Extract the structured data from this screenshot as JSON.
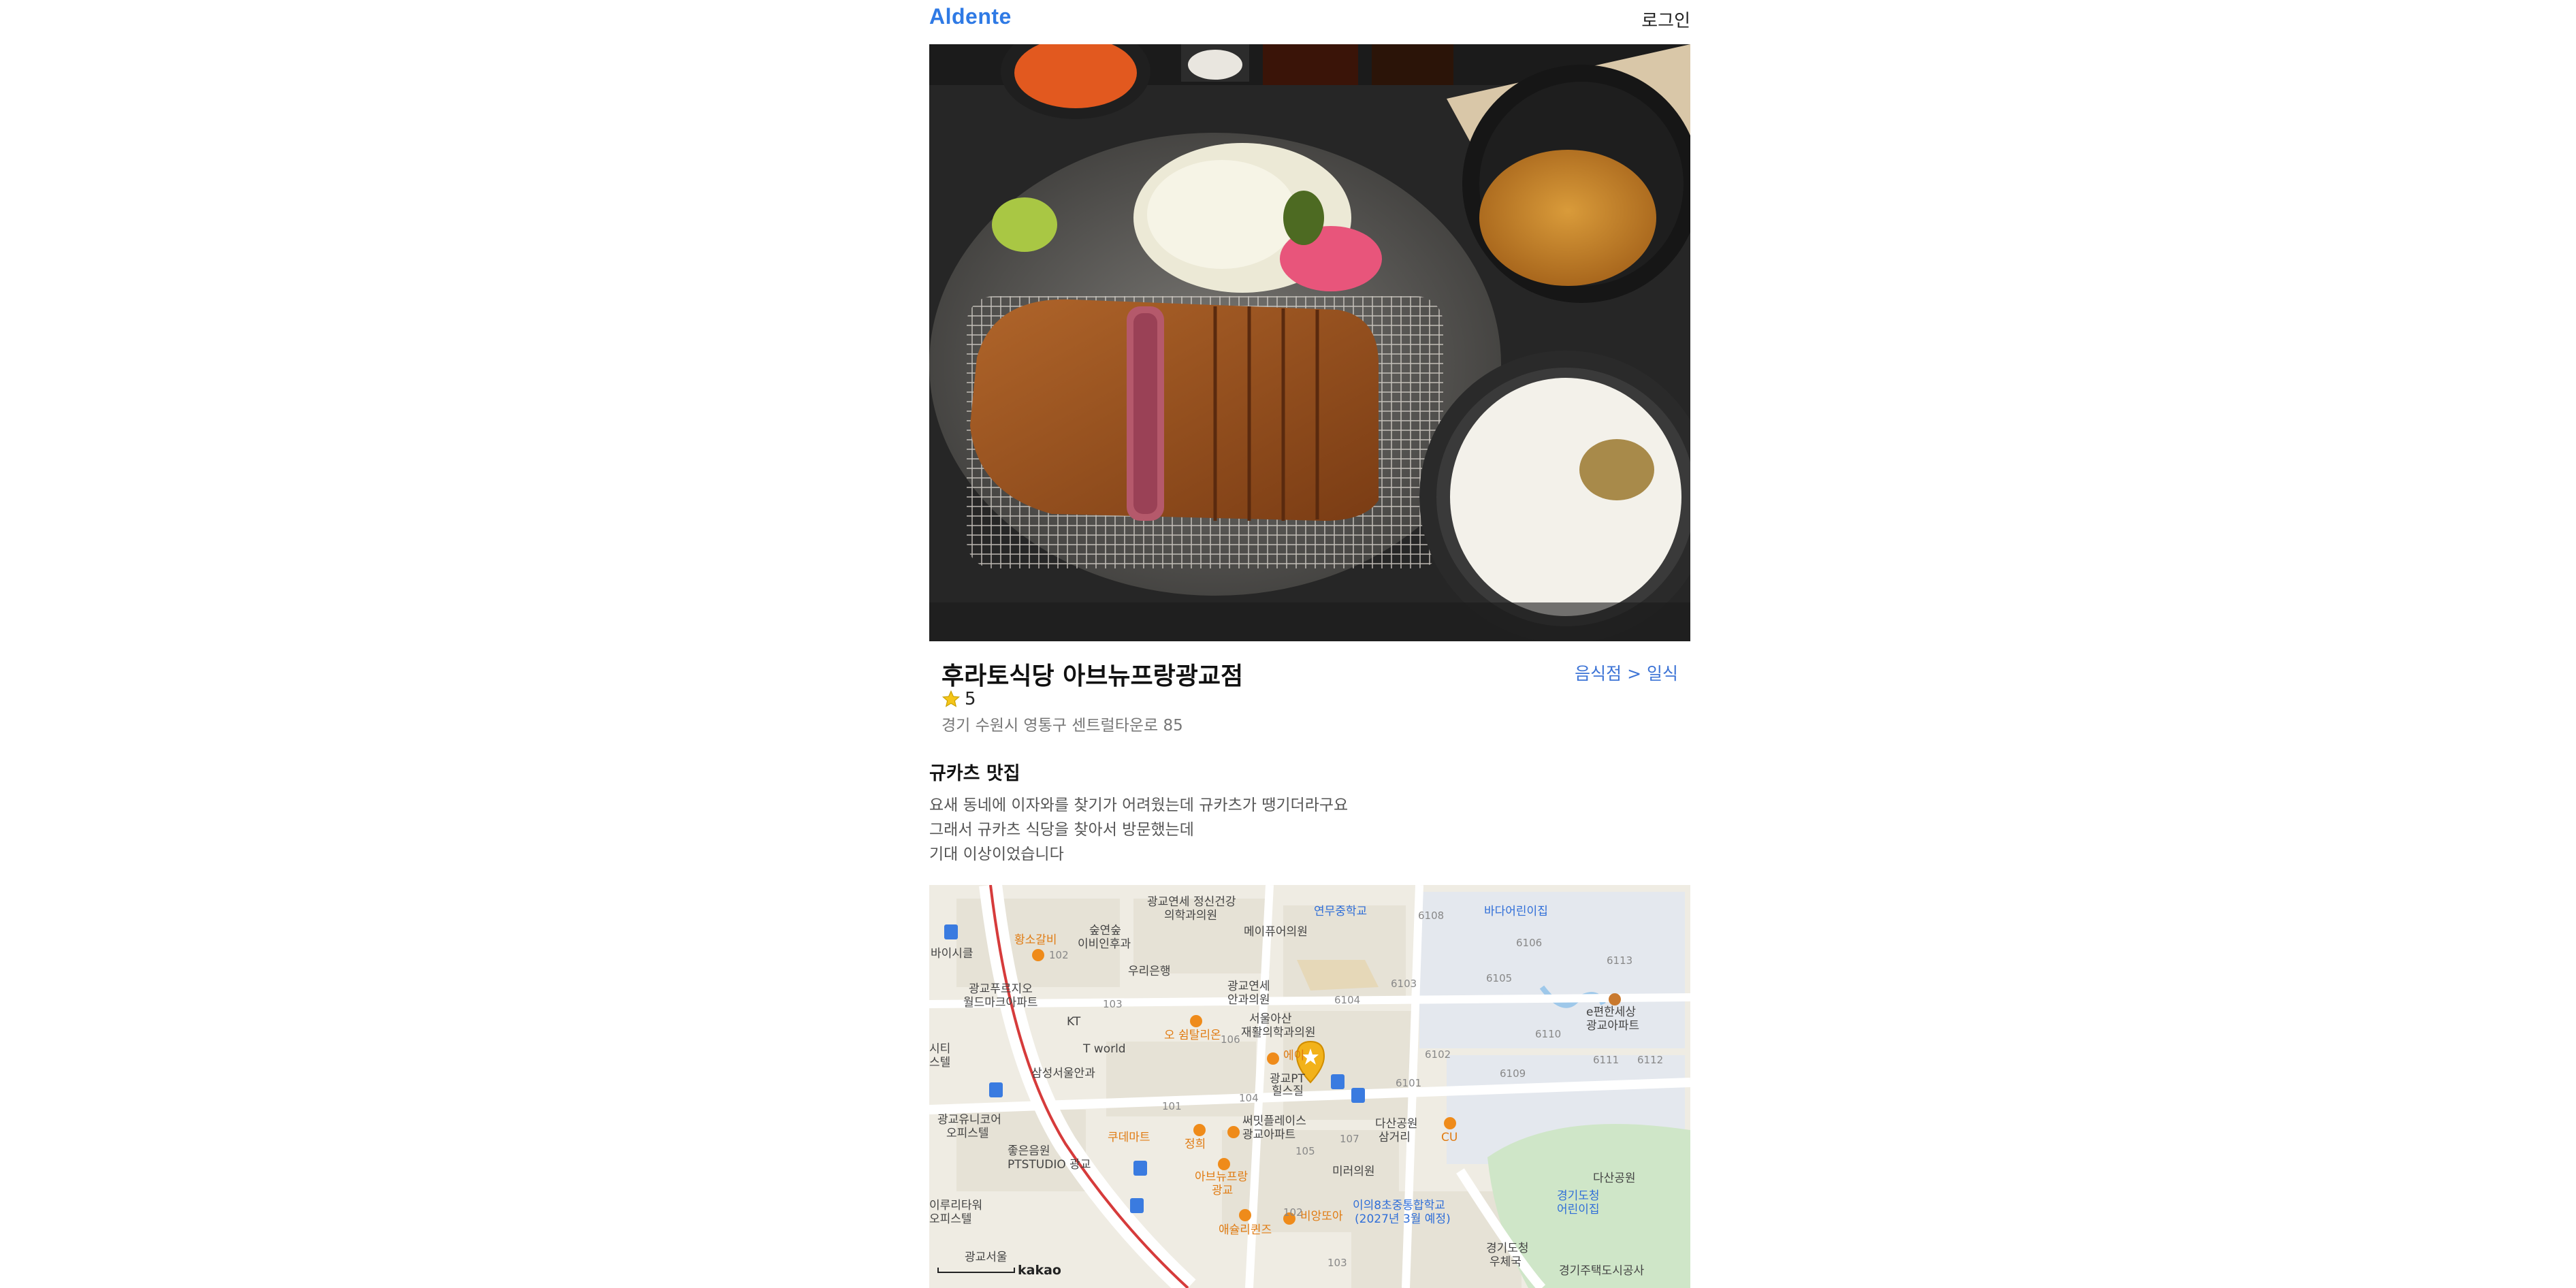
{
  "header": {
    "logo": "Aldente",
    "login_label": "로그인"
  },
  "restaurant": {
    "name": "후라토식당 아브뉴프랑광교점",
    "category": "음식점 > 일식",
    "rating": "5",
    "address": "경기 수원시 영통구 센트럴타운로 85"
  },
  "review": {
    "title": "규카츠 맛집",
    "lines": [
      "요새 동네에 이자와를 찾기가 어려웠는데 규카츠가 땡기더라구요",
      "그래서 규카츠 식당을 찾아서 방문했는데",
      "기대 이상이었습니다"
    ]
  },
  "map": {
    "attribution": "kakao",
    "labels": [
      "광교연세 정신건강",
      "의학과의원",
      "연무중학교",
      "바다어린이집",
      "숲연숲",
      "이비인후과",
      "메이퓨어의원",
      "바이시클",
      "황소갈비",
      "광교푸르지오",
      "월드마크아파트",
      "우리은행",
      "광교연세",
      "안과의원",
      "KT",
      "T world",
      "오 쉼탈리온",
      "서울아산",
      "재활의학과의원",
      "에이",
      "e편한세상",
      "광교아파트",
      "삼성서울안과",
      "광교PT",
      "힐스질",
      "광교유니코어",
      "오피스텔",
      "쿠데마트",
      "정희",
      "써밋플레이스",
      "광교아파트",
      "다산공원",
      "삼거리",
      "CU",
      "좋은음원",
      "PTSTUDIO 광교",
      "아브뉴프랑",
      "광교",
      "미러의원",
      "이의8초중통합학교",
      "(2027년 3월 예정)",
      "경기도청",
      "어린이집",
      "다산공원",
      "이루리타워",
      "오피스텔",
      "애슐리퀸즈",
      "비앙또아",
      "광교서울",
      "경기도청",
      "우체국",
      "경기주택도시공사",
      "시티",
      "스텔"
    ],
    "numbers": [
      "102",
      "103",
      "101",
      "104",
      "105",
      "107",
      "102",
      "103",
      "6108",
      "6106",
      "6113",
      "6105",
      "6103",
      "6104",
      "6102",
      "6110",
      "6111",
      "6112",
      "6101",
      "6109",
      "106"
    ]
  },
  "colors": {
    "brand": "#2f7ae5",
    "category": "#3d74d6",
    "marker": "#f2b21a"
  }
}
